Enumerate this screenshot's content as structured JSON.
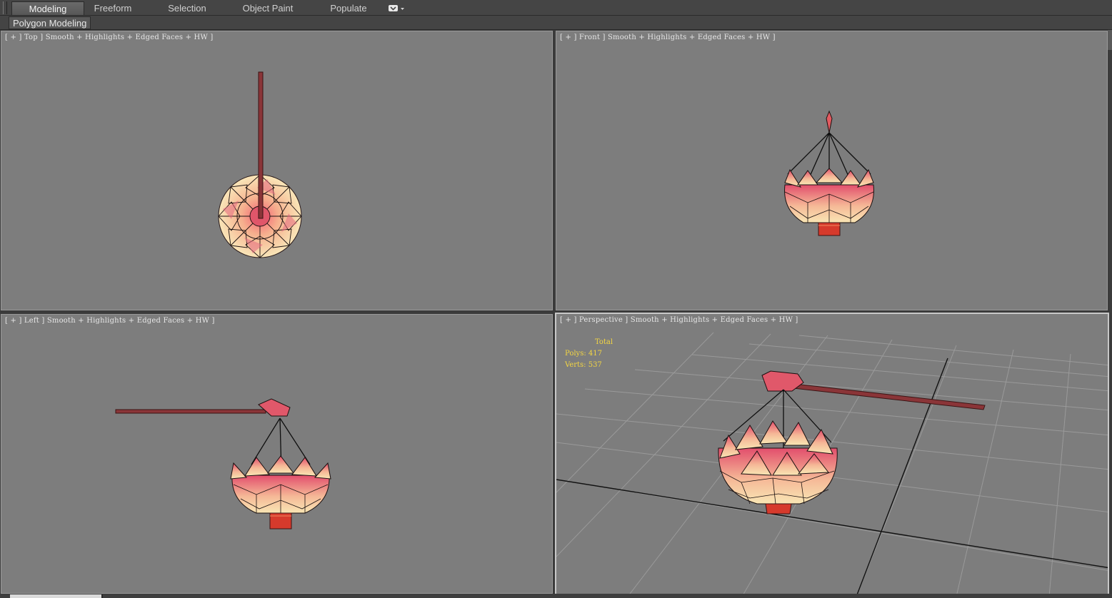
{
  "ribbon": {
    "tabs": [
      {
        "label": "Modeling",
        "active": true
      },
      {
        "label": "Freeform",
        "active": false
      },
      {
        "label": "Selection",
        "active": false
      },
      {
        "label": "Object Paint",
        "active": false
      },
      {
        "label": "Populate",
        "active": false
      }
    ],
    "subtab": "Polygon Modeling"
  },
  "viewports": {
    "top": {
      "label": "[ + ] Top ] Smooth + Highlights + Edged Faces + HW ]"
    },
    "front": {
      "label": "[ + ] Front ] Smooth + Highlights + Edged Faces + HW ]"
    },
    "left": {
      "label": "[ + ] Left ] Smooth + Highlights + Edged Faces + HW ]"
    },
    "perspective": {
      "label": "[ + ] Perspective ] Smooth + Highlights + Edged Faces + HW ]",
      "stats": {
        "header": "Total",
        "polys": "Polys: 417",
        "verts": "Verts: 537"
      }
    }
  },
  "colors": {
    "viewport_bg": "#7d7d7d",
    "petal_pink": "#e4607a",
    "petal_cream": "#f8e4b0",
    "pole_red": "#8a3538",
    "base_red": "#d63a2c",
    "stats_yellow": "#f4d642"
  }
}
